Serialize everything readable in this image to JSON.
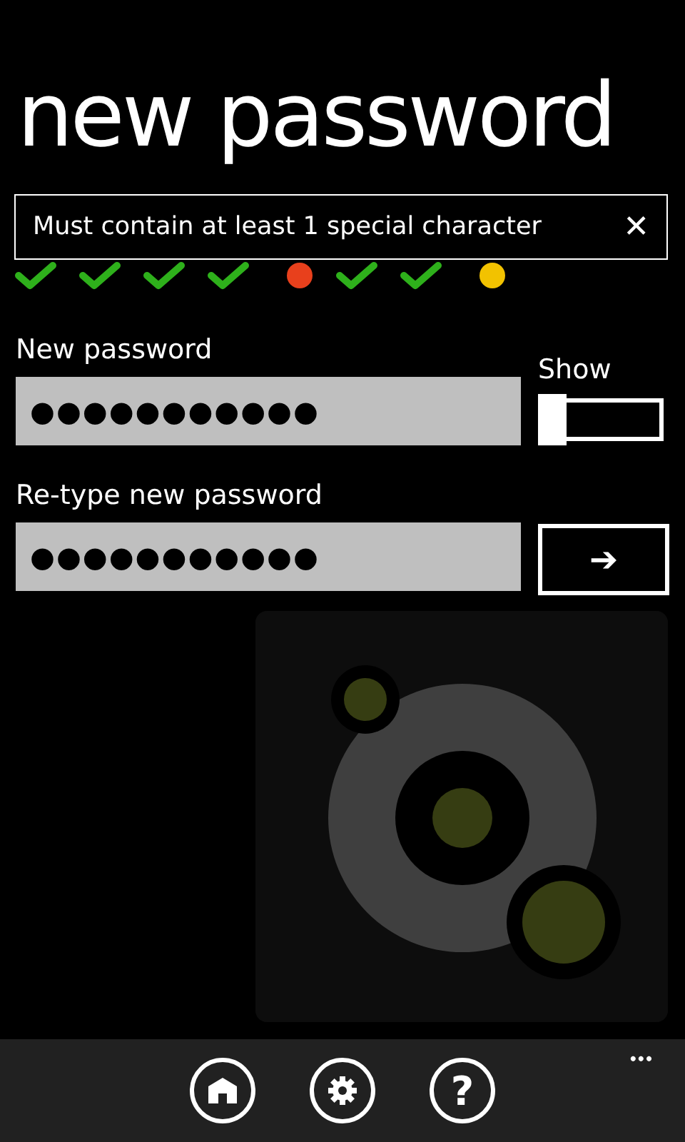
{
  "page": {
    "title": "new password"
  },
  "message": {
    "text": "Must contain at least 1 special character",
    "close": "✕"
  },
  "requirements": [
    {
      "kind": "check"
    },
    {
      "kind": "check"
    },
    {
      "kind": "check"
    },
    {
      "kind": "check"
    },
    {
      "kind": "dot",
      "color": "#e8401c"
    },
    {
      "kind": "check"
    },
    {
      "kind": "check"
    },
    {
      "kind": "dot",
      "color": "#f2c200"
    }
  ],
  "new_password": {
    "label": "New password",
    "value": "●●●●●●●●●●●"
  },
  "show": {
    "label": "Show",
    "on": false
  },
  "retype_password": {
    "label": "Re-type new password",
    "value": "●●●●●●●●●●●"
  },
  "submit": {
    "glyph": "➔"
  },
  "app_bar": {
    "buttons": [
      {
        "kind": "home"
      },
      {
        "kind": "settings"
      },
      {
        "kind": "help",
        "glyph": "?"
      }
    ],
    "more": "•••"
  }
}
